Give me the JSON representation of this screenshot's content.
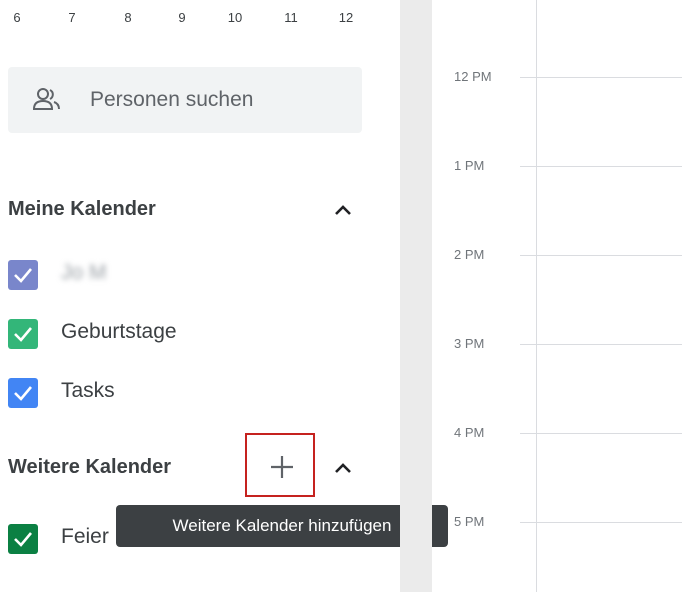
{
  "mini_calendar": {
    "days": [
      "6",
      "7",
      "8",
      "9",
      "10",
      "11",
      "12"
    ]
  },
  "search": {
    "placeholder": "Personen suchen",
    "icon": "people-icon"
  },
  "my_calendars": {
    "title": "Meine Kalender",
    "items": [
      {
        "label": "Jo M",
        "color": "#7986cb",
        "checked": true
      },
      {
        "label": "Geburtstage",
        "color": "#33b679",
        "checked": true
      },
      {
        "label": "Tasks",
        "color": "#4285f4",
        "checked": true
      }
    ]
  },
  "other_calendars": {
    "title": "Weitere Kalender",
    "add_tooltip": "Weitere Kalender hinzufügen",
    "items": [
      {
        "label": "Feier",
        "color": "#0b8043",
        "checked": true
      }
    ]
  },
  "timeline": {
    "hours": [
      "12 PM",
      "1 PM",
      "2 PM",
      "3 PM",
      "4 PM",
      "5 PM"
    ]
  },
  "colors": {
    "highlight": "#c5221f",
    "tooltip_bg": "#3c4043"
  }
}
